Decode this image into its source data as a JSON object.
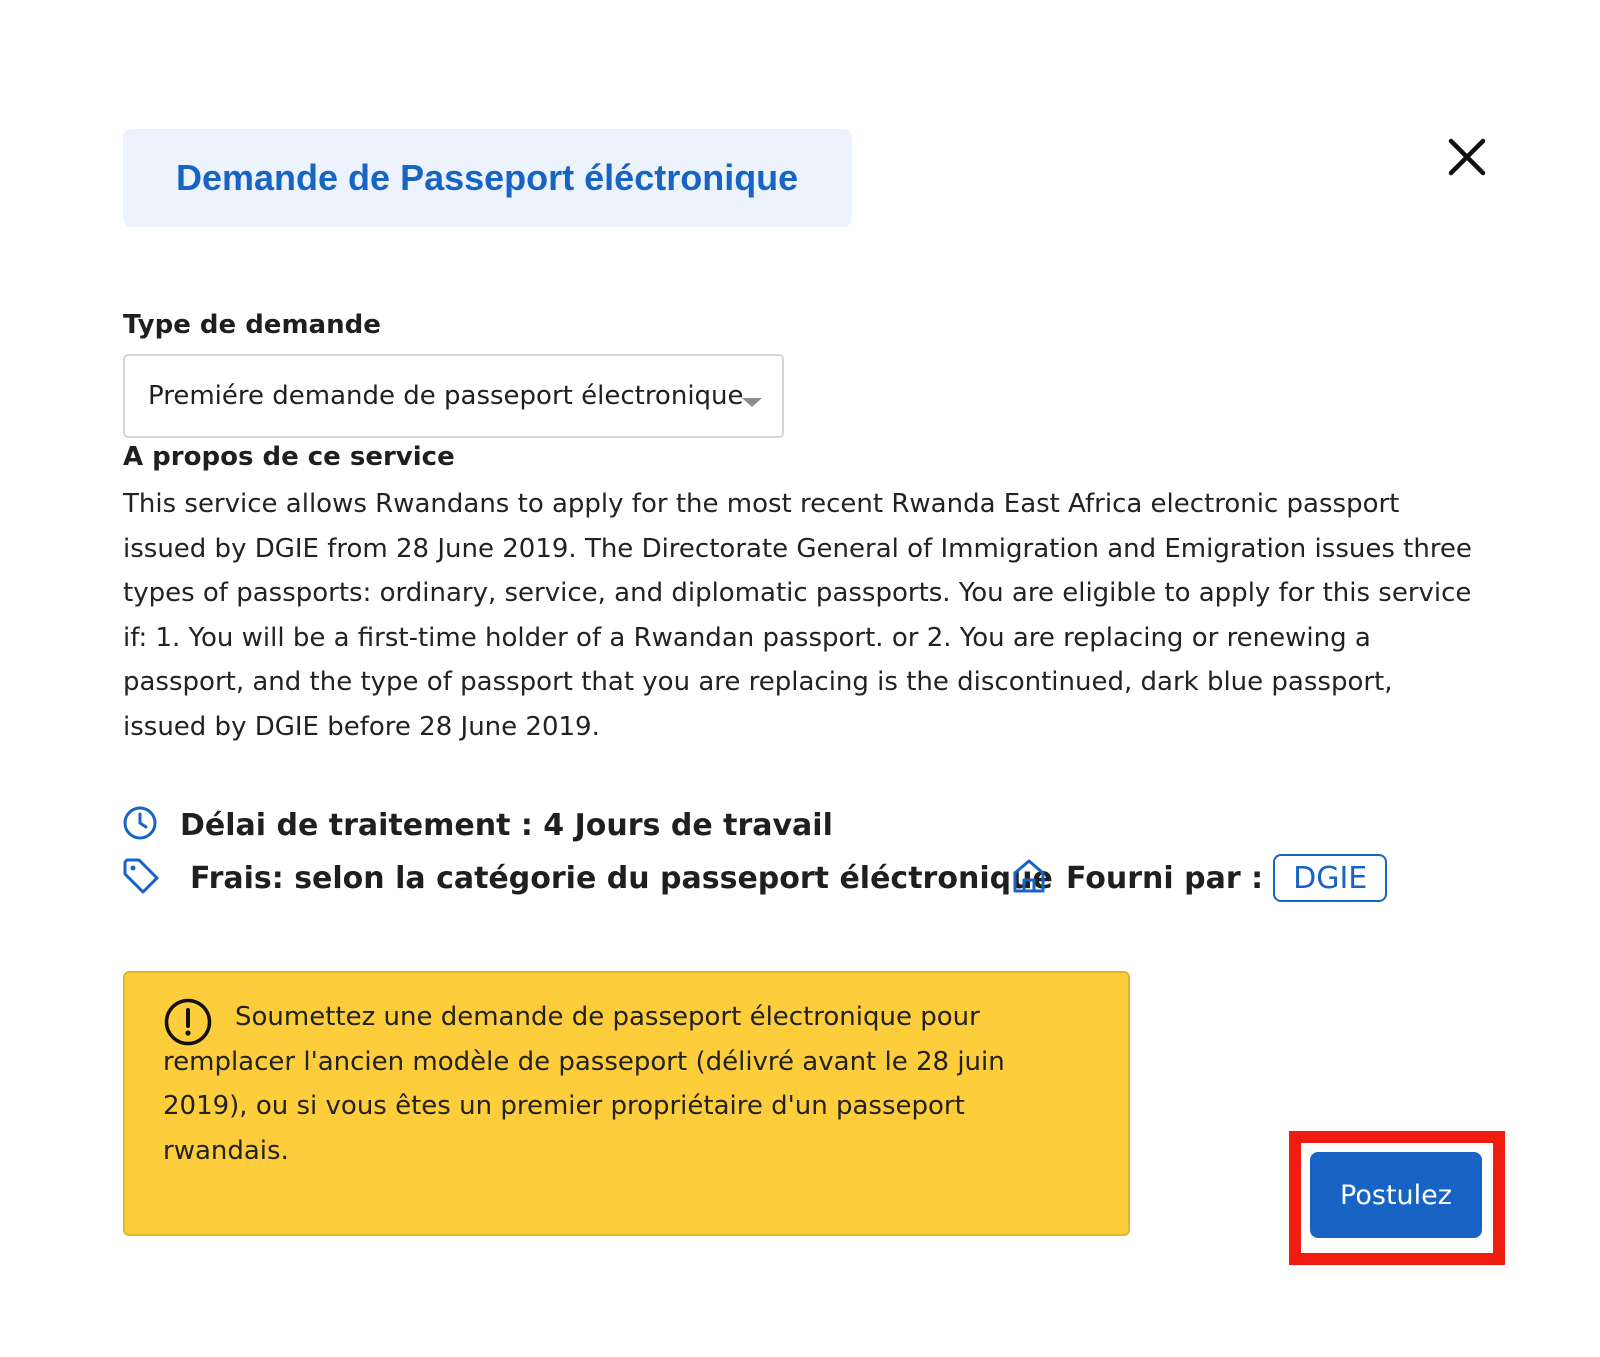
{
  "header": {
    "title": "Demande de Passeport éléctronique",
    "close_icon": "close-icon"
  },
  "request_type": {
    "label": "Type de demande",
    "selected": "Premiére demande de passeport électronique"
  },
  "about": {
    "heading": "A propos de ce service",
    "text": "This service allows Rwandans to apply for the most recent Rwanda East Africa electronic passport issued by DGIE from 28 June 2019. The Directorate General of Immigration and Emigration issues three types of passports: ordinary, service, and diplomatic passports. You are eligible to apply for this service if: 1. You will be a first-time holder of a Rwandan passport. or 2. You are replacing or renewing a passport, and the type of passport that you are replacing is the discontinued, dark blue passport, issued by DGIE before 28 June 2019."
  },
  "meta": {
    "processing_time": "Délai de traitement : 4 Jours de travail",
    "fees": "Frais: selon la catégorie du passeport éléctronique",
    "provider_label": "Fourni par :",
    "provider": "DGIE",
    "icons": [
      "clock-icon",
      "tag-icon",
      "home-icon"
    ]
  },
  "notice": {
    "icon": "exclamation-icon",
    "text": "Soumettez une demande de passeport électronique pour remplacer l'ancien modèle de passeport (délivré avant le 28 juin 2019), ou si vous êtes un premier propriétaire d'un passeport rwandais."
  },
  "actions": {
    "apply_label": "Postulez"
  },
  "colors": {
    "accent": "#1764c4",
    "title_bg": "#edf3fc",
    "notice_bg": "#fdcd3b",
    "highlight": "#f01c0f"
  }
}
